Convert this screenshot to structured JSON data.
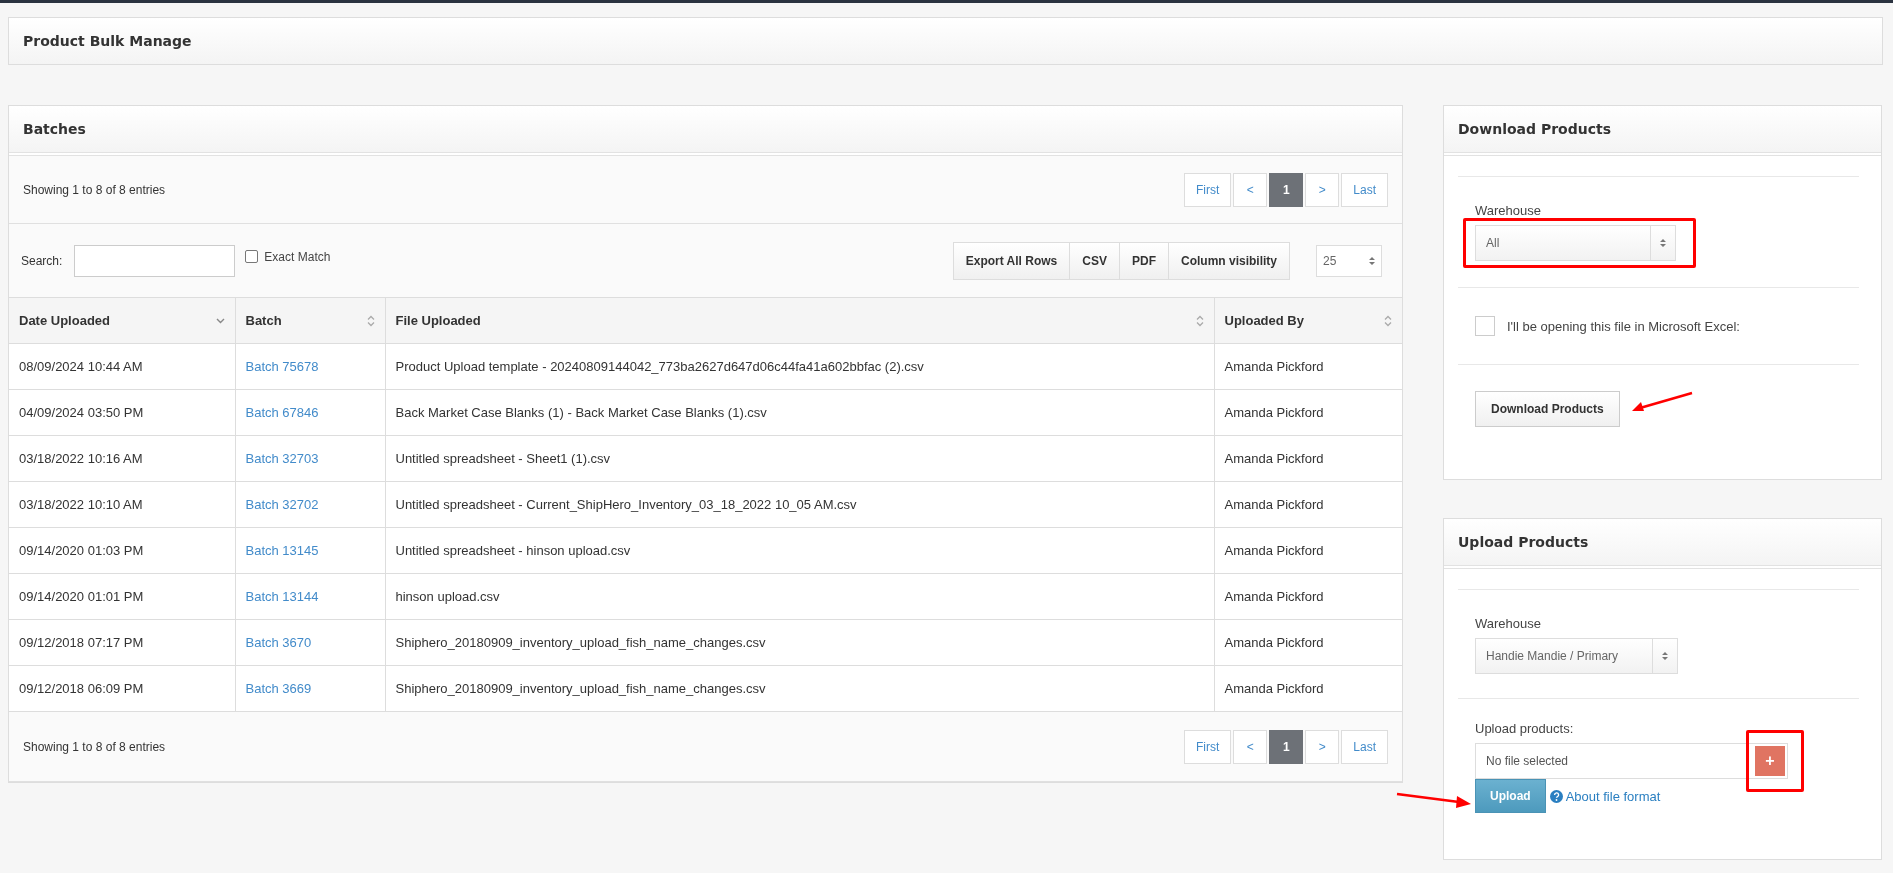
{
  "page_title": "Product Bulk Manage",
  "batches": {
    "title": "Batches",
    "info_top": "Showing 1 to 8 of 8 entries",
    "pagination_top": [
      {
        "label": "First",
        "selected": false
      },
      {
        "label": "<",
        "selected": false
      },
      {
        "label": "1",
        "selected": true
      },
      {
        "label": ">",
        "selected": false
      },
      {
        "label": "Last",
        "selected": false
      }
    ],
    "search": {
      "label": "Search:"
    },
    "exact_match": {
      "label": "Exact Match",
      "checked": false
    },
    "export_buttons": [
      "Export All Rows",
      "CSV",
      "PDF",
      "Column visibility"
    ],
    "page_size": "25",
    "columns": [
      {
        "label": "Date Uploaded",
        "sorted": true
      },
      {
        "label": "Batch",
        "sorted": false
      },
      {
        "label": "File Uploaded",
        "sorted": false
      },
      {
        "label": "Uploaded By",
        "sorted": false
      }
    ],
    "rows": [
      {
        "date": "08/09/2024 10:44 AM",
        "batch": "Batch 75678",
        "file": "Product Upload template - 20240809144042_773ba2627d647d06c44fa41a602bbfac (2).csv",
        "user": "Amanda Pickford"
      },
      {
        "date": "04/09/2024 03:50 PM",
        "batch": "Batch 67846",
        "file": "Back Market Case Blanks (1) - Back Market Case Blanks (1).csv",
        "user": "Amanda Pickford"
      },
      {
        "date": "03/18/2022 10:16 AM",
        "batch": "Batch 32703",
        "file": "Untitled spreadsheet - Sheet1 (1).csv",
        "user": "Amanda Pickford"
      },
      {
        "date": "03/18/2022 10:10 AM",
        "batch": "Batch 32702",
        "file": "Untitled spreadsheet - Current_ShipHero_Inventory_03_18_2022 10_05 AM.csv",
        "user": "Amanda Pickford"
      },
      {
        "date": "09/14/2020 01:03 PM",
        "batch": "Batch 13145",
        "file": "Untitled spreadsheet - hinson upload.csv",
        "user": "Amanda Pickford"
      },
      {
        "date": "09/14/2020 01:01 PM",
        "batch": "Batch 13144",
        "file": "hinson upload.csv",
        "user": "Amanda Pickford"
      },
      {
        "date": "09/12/2018 07:17 PM",
        "batch": "Batch 3670",
        "file": "Shiphero_20180909_inventory_upload_fish_name_changes.csv",
        "user": "Amanda Pickford"
      },
      {
        "date": "09/12/2018 06:09 PM",
        "batch": "Batch 3669",
        "file": "Shiphero_20180909_inventory_upload_fish_name_changes.csv",
        "user": "Amanda Pickford"
      }
    ],
    "info_bottom": "Showing 1 to 8 of 8 entries",
    "pagination_bottom": [
      {
        "label": "First",
        "selected": false
      },
      {
        "label": "<",
        "selected": false
      },
      {
        "label": "1",
        "selected": true
      },
      {
        "label": ">",
        "selected": false
      },
      {
        "label": "Last",
        "selected": false
      }
    ]
  },
  "download": {
    "title": "Download Products",
    "warehouse_label": "Warehouse",
    "warehouse_value": "All",
    "warehouse_highlighted": true,
    "excel": {
      "label": "I'll be opening this file in Microsoft Excel:",
      "checked": false
    },
    "button": "Download Products",
    "button_pointed": true
  },
  "upload": {
    "title": "Upload Products",
    "warehouse_label": "Warehouse",
    "warehouse_value": "Handie Mandie / Primary",
    "file_label": "Upload products:",
    "file_placeholder": "No file selected",
    "add_button": "+",
    "add_highlighted": true,
    "button": "Upload",
    "button_pointed": true,
    "help_link": "About file format"
  }
}
